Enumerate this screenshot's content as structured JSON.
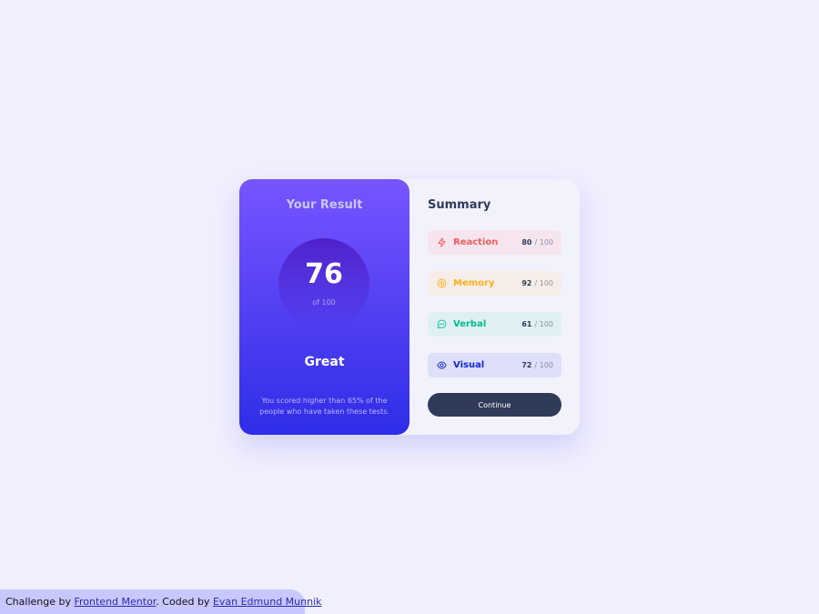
{
  "result": {
    "title": "Your Result",
    "score": "76",
    "of_label": "of 100",
    "grade": "Great",
    "description": "You scored higher than 65% of the people who have taken these tests."
  },
  "summary": {
    "title": "Summary",
    "items": [
      {
        "label": "Reaction",
        "score": "80",
        "max": "/ 100",
        "icon": "lightning-icon",
        "color": "#f55c5c"
      },
      {
        "label": "Memory",
        "score": "92",
        "max": "/ 100",
        "icon": "brain-icon",
        "color": "#ffb01f"
      },
      {
        "label": "Verbal",
        "score": "61",
        "max": "/ 100",
        "icon": "chat-bubble-icon",
        "color": "#00bb8f"
      },
      {
        "label": "Visual",
        "score": "72",
        "max": "/ 100",
        "icon": "eye-icon",
        "color": "#1125d6"
      }
    ],
    "continue_label": "Continue"
  },
  "attribution": {
    "prefix": "Challenge by ",
    "challenge_link": "Frontend Mentor",
    "middle": ". Coded by ",
    "author_link": "Evan Edmund Munnik"
  },
  "colors": {
    "background": "#efeffe",
    "gradient_top": "#7755ff",
    "gradient_bottom": "#2f2de8",
    "dark_navy": "#303b5a"
  }
}
